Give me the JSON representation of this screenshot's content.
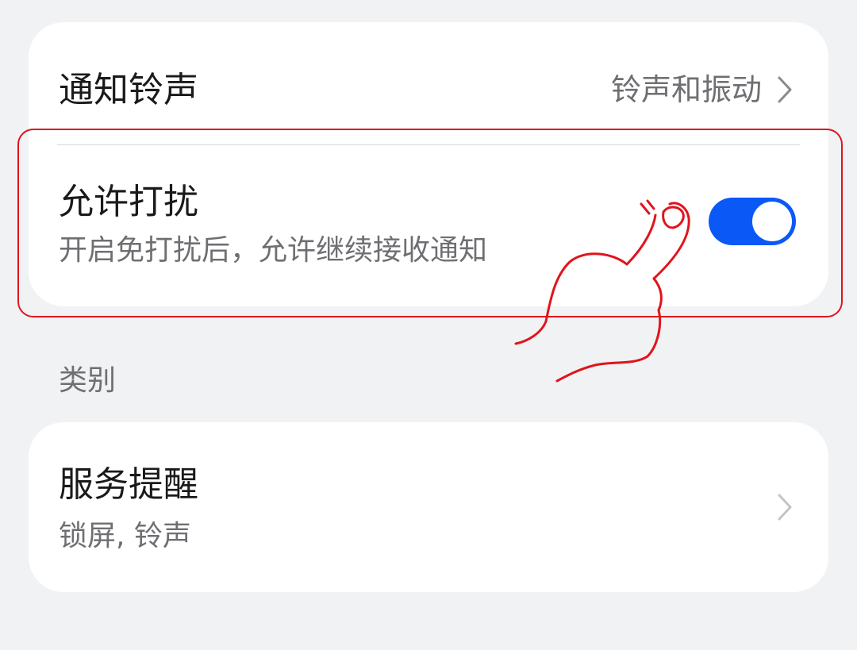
{
  "notification_sound": {
    "title": "通知铃声",
    "value": "铃声和振动"
  },
  "allow_interrupt": {
    "title": "允许打扰",
    "subtitle": "开启免打扰后，允许继续接收通知",
    "enabled": true
  },
  "category_header": "类别",
  "service_reminder": {
    "title": "服务提醒",
    "subtitle": "锁屏, 铃声"
  },
  "colors": {
    "toggle_on": "#0a59f7",
    "annotation": "#e0141c",
    "background": "#f1f2f4"
  },
  "icons": [
    "chevron-right-icon",
    "pointing-hand-icon"
  ]
}
